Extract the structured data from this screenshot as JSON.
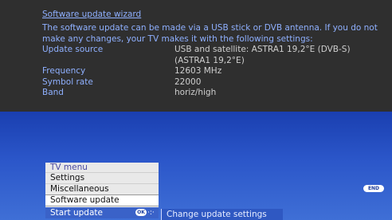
{
  "wizard": {
    "title": "Software update wizard",
    "intro": "The software update can be made via a USB stick or DVB antenna. If you do not make any changes, your TV makes it with the following settings:",
    "settings": [
      {
        "label": "Update source",
        "value": "USB and satellite: ASTRA1 19,2°E (DVB-S)"
      },
      {
        "label": "",
        "value": "(ASTRA1 19,2°E)"
      },
      {
        "label": "Frequency",
        "value": "12603 MHz"
      },
      {
        "label": "Symbol rate",
        "value": "22000"
      },
      {
        "label": "Band",
        "value": "horiz/high"
      }
    ]
  },
  "menu": {
    "title": "TV menu",
    "items": [
      "Settings",
      "Miscellaneous",
      "Software update"
    ],
    "active": "Start update",
    "ok_label": "OK",
    "arrows_label": "·:·",
    "submenu": "Change update settings"
  },
  "end_label": "END",
  "colors": {
    "panel": "#2f2f2f",
    "blue": "#2b56c9",
    "highlight_text": "#8fb0ff"
  }
}
